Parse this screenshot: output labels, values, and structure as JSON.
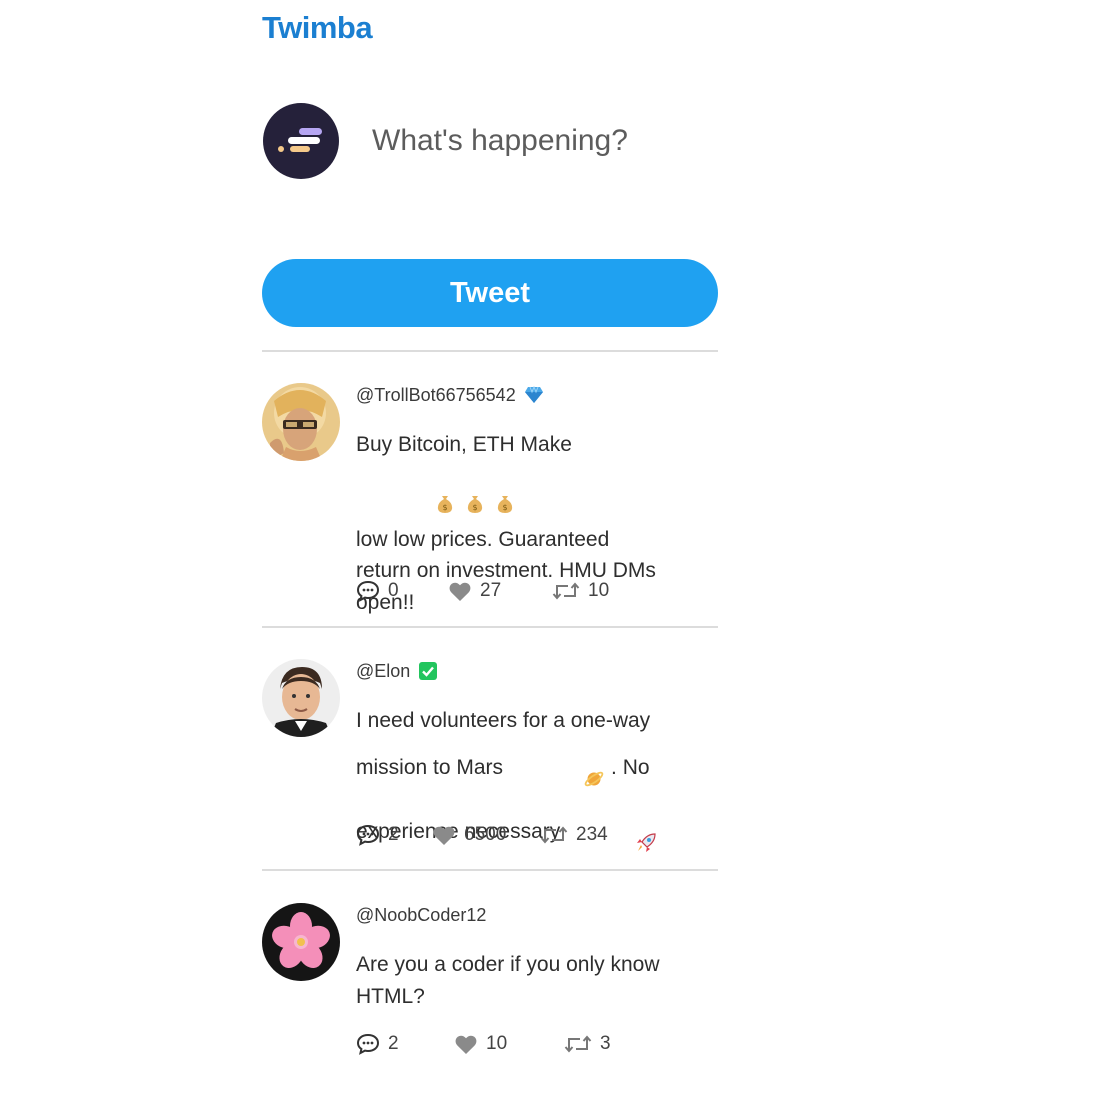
{
  "app": {
    "title": "Twimba"
  },
  "composer": {
    "placeholder": "What's happening?",
    "button_label": "Tweet"
  },
  "tweets": [
    {
      "handle": "@TrollBot66756542",
      "badge": "diamond-icon",
      "lines": [
        "Buy Bitcoin, ETH Make",
        "low low prices. Guaranteed",
        "return on investment. HMU DMs",
        "open!!"
      ],
      "replies": "0",
      "likes": "27",
      "retweets": "10"
    },
    {
      "handle": "@Elon",
      "badge": "verified-check-icon",
      "lines": [
        "I need volunteers for a one-way",
        "mission to Mars",
        ". No",
        "experience necessary"
      ],
      "replies": "2",
      "likes": "6500",
      "retweets": "234"
    },
    {
      "handle": "@NoobCoder12",
      "badge": "",
      "lines": [
        "Are you a coder if you only know",
        "HTML?"
      ],
      "replies": "2",
      "likes": "10",
      "retweets": "3"
    }
  ],
  "colors": {
    "brand": "#1b7fd1",
    "button": "#1fa1f1",
    "divider": "#dcdcdc"
  }
}
